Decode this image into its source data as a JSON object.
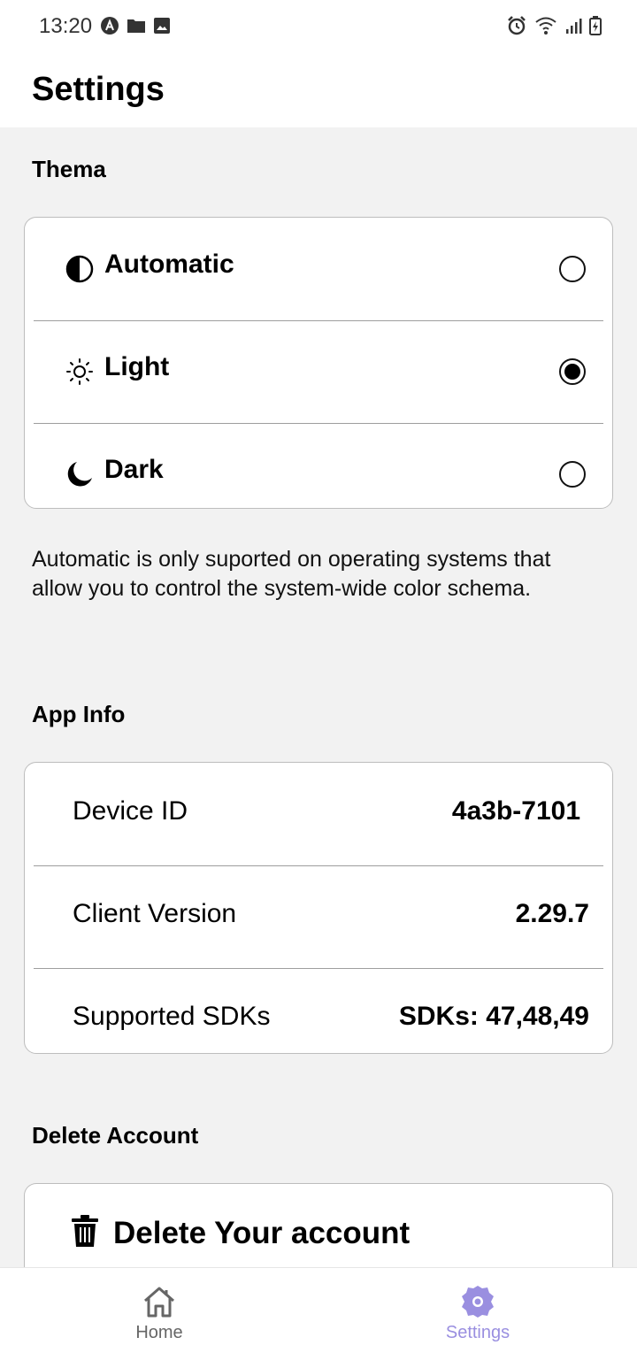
{
  "status_bar": {
    "time": "13:20"
  },
  "app_bar": {
    "title": "Settings"
  },
  "theme_section": {
    "title": "Thema",
    "options": [
      {
        "label": "Automatic",
        "icon": "half-circle-icon",
        "selected": false
      },
      {
        "label": "Light",
        "icon": "sun-icon",
        "selected": true
      },
      {
        "label": "Dark",
        "icon": "moon-icon",
        "selected": false
      }
    ],
    "note": "Automatic is only suported on operating systems that  allow you to control the  system-wide color schema."
  },
  "app_info": {
    "title": "App Info",
    "rows": [
      {
        "key": "Device ID",
        "value": "4a3b-7101"
      },
      {
        "key": "Client Version",
        "value": "2.29.7"
      },
      {
        "key": "Supported SDKs",
        "value": "SDKs: 47,48,49"
      }
    ]
  },
  "delete_section": {
    "title": "Delete Account",
    "button_label": "Delete Your account"
  },
  "bottom_nav": {
    "items": [
      {
        "label": "Home",
        "active": false
      },
      {
        "label": "Settings",
        "active": true
      }
    ],
    "active_color": "#9a8fe0",
    "inactive_color": "#666666"
  }
}
